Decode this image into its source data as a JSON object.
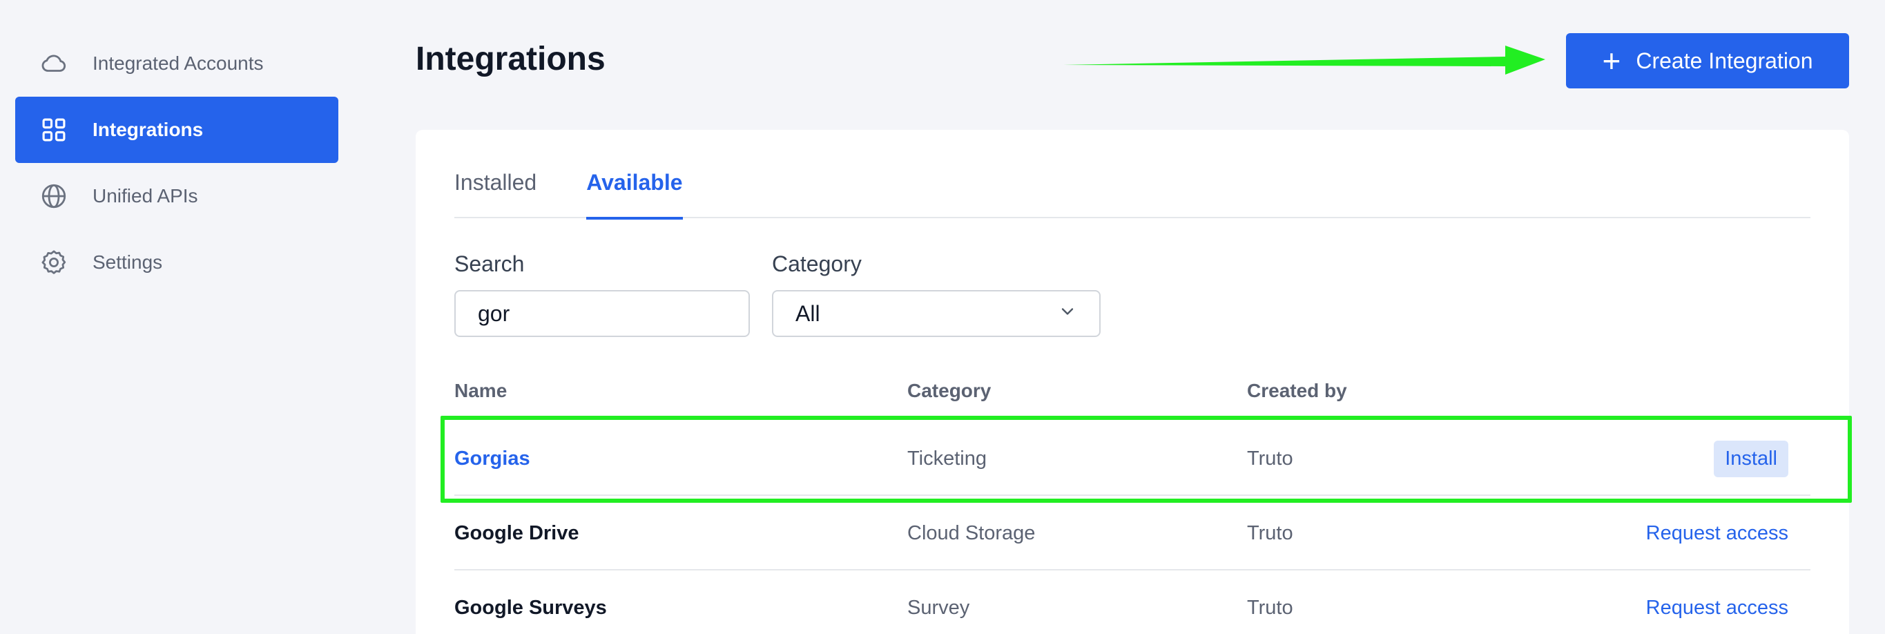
{
  "sidebar": {
    "items": [
      {
        "label": "Integrated Accounts",
        "icon": "cloud-icon",
        "active": false
      },
      {
        "label": "Integrations",
        "icon": "grid-icon",
        "active": true
      },
      {
        "label": "Unified APIs",
        "icon": "globe-icon",
        "active": false
      },
      {
        "label": "Settings",
        "icon": "gear-icon",
        "active": false
      }
    ]
  },
  "header": {
    "title": "Integrations",
    "create_button_label": "Create Integration",
    "create_button_icon": "plus-icon"
  },
  "tabs": [
    {
      "label": "Installed",
      "active": false
    },
    {
      "label": "Available",
      "active": true
    }
  ],
  "filters": {
    "search_label": "Search",
    "search_value": "gor",
    "category_label": "Category",
    "category_value": "All"
  },
  "table": {
    "headers": {
      "name": "Name",
      "category": "Category",
      "created_by": "Created by"
    },
    "rows": [
      {
        "name": "Gorgias",
        "category": "Ticketing",
        "created_by": "Truto",
        "action": "Install"
      },
      {
        "name": "Google Drive",
        "category": "Cloud Storage",
        "created_by": "Truto",
        "action": "Request access"
      },
      {
        "name": "Google Surveys",
        "category": "Survey",
        "created_by": "Truto",
        "action": "Request access"
      }
    ]
  },
  "colors": {
    "accent": "#2563eb",
    "highlight": "#22ee22",
    "background": "#f4f5f9"
  }
}
